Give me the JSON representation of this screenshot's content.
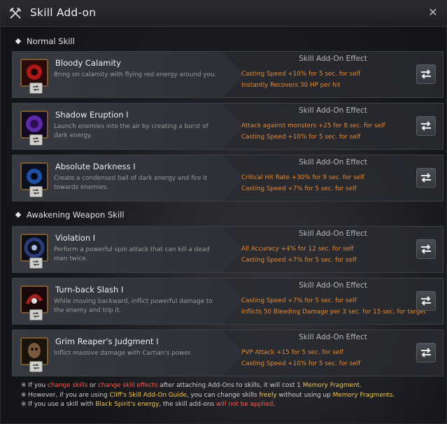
{
  "window": {
    "title": "Skill Add-on",
    "title_icon": "crossed-axes-icon",
    "close_icon": "close-icon"
  },
  "sections": {
    "normal": "Normal Skill",
    "awakening": "Awakening Weapon Skill"
  },
  "effect_header": "Skill Add-On Effect",
  "skills": [
    {
      "name": "Bloody Calamity",
      "desc": "Bring on calamity with flying red energy around you.",
      "effects": [
        "Casting Speed +10% for 5 sec. for self",
        "Instantly Recovers 30 HP per hit"
      ],
      "icon_color": "#b01818"
    },
    {
      "name": "Shadow Eruption I",
      "desc": "Launch enemies into the air by creating a burst of dark energy.",
      "effects": [
        "Attack against monsters +25 for 8 sec. for self",
        "Casting Speed +10% for 5 sec. for self"
      ],
      "icon_color": "#5b2aa8"
    },
    {
      "name": "Absolute Darkness I",
      "desc": "Create a condensed ball of dark energy and fire it towards enemies.",
      "effects": [
        "Critical Hit Rate +30% for 9 sec. for self",
        "Casting Speed +7% for 5 sec. for self"
      ],
      "icon_color": "#1f4fa3"
    },
    {
      "name": "Violation I",
      "desc": "Perform a powerful spin attack that can kill a dead man twice.",
      "effects": [
        "All Accuracy +4% for 12 sec. for self",
        "Casting Speed +7% for 5 sec. for self"
      ],
      "icon_color": "#2a3d7a"
    },
    {
      "name": "Turn-back Slash I",
      "desc": "While moving backward, inflict powerful damage to the enemy and trip it.",
      "effects": [
        "Casting Speed +7% for 5 sec. for self",
        "Inflicts 50 Bleeding Damage per 3 sec. for 15 sec. for target"
      ],
      "icon_color": "#a82020"
    },
    {
      "name": "Grim Reaper's Judgment I",
      "desc": "Inflict massive damage with Cartian's power.",
      "effects": [
        "PVP Attack +15 for 5 sec. for self",
        "Casting Speed +10% for 5 sec. for self"
      ],
      "icon_color": "#7a5a3a"
    }
  ],
  "notes": [
    {
      "prefix": "※ If you ",
      "hl1": "change skills",
      "mid1": " or ",
      "hl2": "change skill effects",
      "mid2": " after attaching Add-Ons to skills, it will cost 1 ",
      "hl3": "Memory Fragment",
      "end": "."
    },
    {
      "prefix": "※ However, if you are using ",
      "hl1": "Cliff's Skill Add-On Guide",
      "mid1": ", you can change skills ",
      "hl2": "freely",
      "mid2": " without using up ",
      "hl3": "Memory Fragments",
      "end": "."
    },
    {
      "prefix": "※ If you use a skill with ",
      "hl1": "Black Spirit's energy",
      "mid1": ", the skill add-ons ",
      "hl2": "will not be applied",
      "end": "."
    }
  ],
  "colors": {
    "effect_text": "#e88a2c",
    "warning_red": "#ff5a4a",
    "highlight_yellow": "#f3c640"
  }
}
